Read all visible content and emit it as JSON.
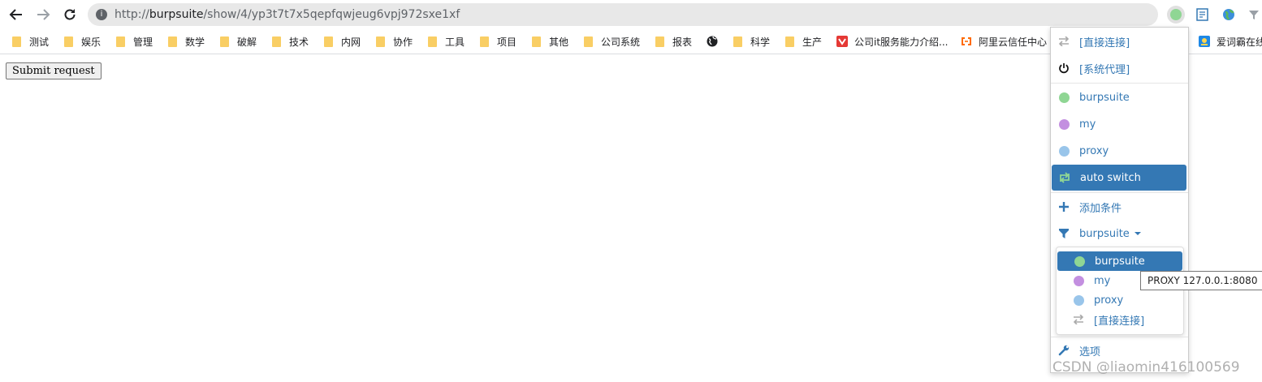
{
  "browser": {
    "url_prefix": "http://",
    "url_host": "burpsuite",
    "url_path": "/show/4/yp3t7t7x5qepfqwjeug6vpj972sxe1xf"
  },
  "bookmarks": [
    {
      "label": "测试",
      "icon": "folder-icon"
    },
    {
      "label": "娱乐",
      "icon": "folder-icon"
    },
    {
      "label": "管理",
      "icon": "folder-icon"
    },
    {
      "label": "数学",
      "icon": "folder-icon"
    },
    {
      "label": "破解",
      "icon": "folder-icon"
    },
    {
      "label": "技术",
      "icon": "folder-icon"
    },
    {
      "label": "内网",
      "icon": "folder-icon"
    },
    {
      "label": "协作",
      "icon": "folder-icon"
    },
    {
      "label": "工具",
      "icon": "folder-icon"
    },
    {
      "label": "项目",
      "icon": "folder-icon"
    },
    {
      "label": "其他",
      "icon": "folder-icon"
    },
    {
      "label": "公司系统",
      "icon": "folder-icon"
    },
    {
      "label": "报表",
      "icon": "folder-icon"
    },
    {
      "label": "",
      "icon": "globe-icon"
    },
    {
      "label": "科学",
      "icon": "folder-icon"
    },
    {
      "label": "生产",
      "icon": "folder-icon"
    },
    {
      "label": "公司it服务能力介绍...",
      "icon": "site-favicon"
    },
    {
      "label": "阿里云信任中心",
      "icon": "aliyun-icon"
    },
    {
      "label": "爱词霸在线",
      "icon": "iciba-icon"
    }
  ],
  "page": {
    "submit_label": "Submit request"
  },
  "proxy_menu": {
    "direct": "[直接连接]",
    "system": "[系统代理]",
    "profiles": [
      {
        "label": "burpsuite",
        "color": "#8fd694"
      },
      {
        "label": "my",
        "color": "#c38fe0"
      },
      {
        "label": "proxy",
        "color": "#99c5ea"
      }
    ],
    "auto_switch": "auto switch",
    "add_condition": "添加条件",
    "current_rule_profile": "burpsuite",
    "options": "选项",
    "accent_color": "#3478b4"
  },
  "submenu": {
    "items": [
      "burpsuite",
      "my",
      "proxy",
      "[直接连接]"
    ]
  },
  "tooltip": "PROXY 127.0.0.1:8080",
  "watermark": "CSDN @liaomin416100569"
}
